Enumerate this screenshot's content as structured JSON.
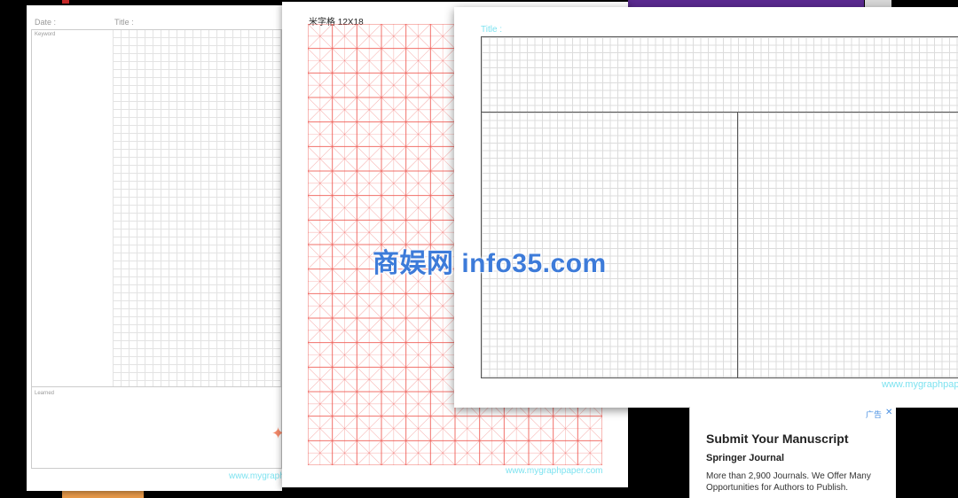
{
  "note_sheet": {
    "date_label": "Date :",
    "title_label": "Title :",
    "keyword_label": "Keyword",
    "learned_label": "Learned",
    "url": "www.mygraphpaper.com"
  },
  "rice_sheet": {
    "title": "米字格 12X18",
    "url": "www.mygraphpaper.com",
    "grid_color": "#f0605a",
    "columns": 12,
    "rows": 18
  },
  "graph_sheet": {
    "title_label": "Title :",
    "url": "www.mygraphpaper.com"
  },
  "ad": {
    "badge": "广告",
    "close_icon": "close-icon",
    "title": "Submit Your Manuscript",
    "subtitle": "Springer Journal",
    "body": "More than 2,900 Journals. We Offer Many Opportunities for Authors to Publish."
  },
  "watermark": "商娱网 info35.com",
  "colors": {
    "accent_cyan": "#7fe3f0",
    "rice_red": "#f0605a",
    "ad_blue": "#4a90e2",
    "watermark_blue": "#3d7bd9"
  }
}
